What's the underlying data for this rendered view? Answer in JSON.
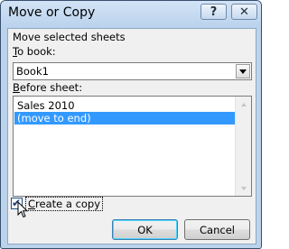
{
  "window": {
    "title": "Move or Copy",
    "help_icon": "?",
    "close_icon": "✕"
  },
  "dialog": {
    "heading": "Move selected sheets",
    "to_book": {
      "label_mnemonic": "T",
      "label_rest": "o book:",
      "selected": "Book1"
    },
    "before_sheet": {
      "label_mnemonic": "B",
      "label_rest": "efore sheet:",
      "items": [
        "Sales 2010",
        "(move to end)"
      ],
      "selected_index": 1
    },
    "create_copy": {
      "label_mnemonic": "C",
      "label_rest": "reate a copy",
      "checked": true
    },
    "buttons": {
      "ok": "OK",
      "cancel": "Cancel"
    }
  },
  "colors": {
    "frame": "#bcd3ec",
    "selection": "#3399ff",
    "client": "#f0f0f0"
  }
}
